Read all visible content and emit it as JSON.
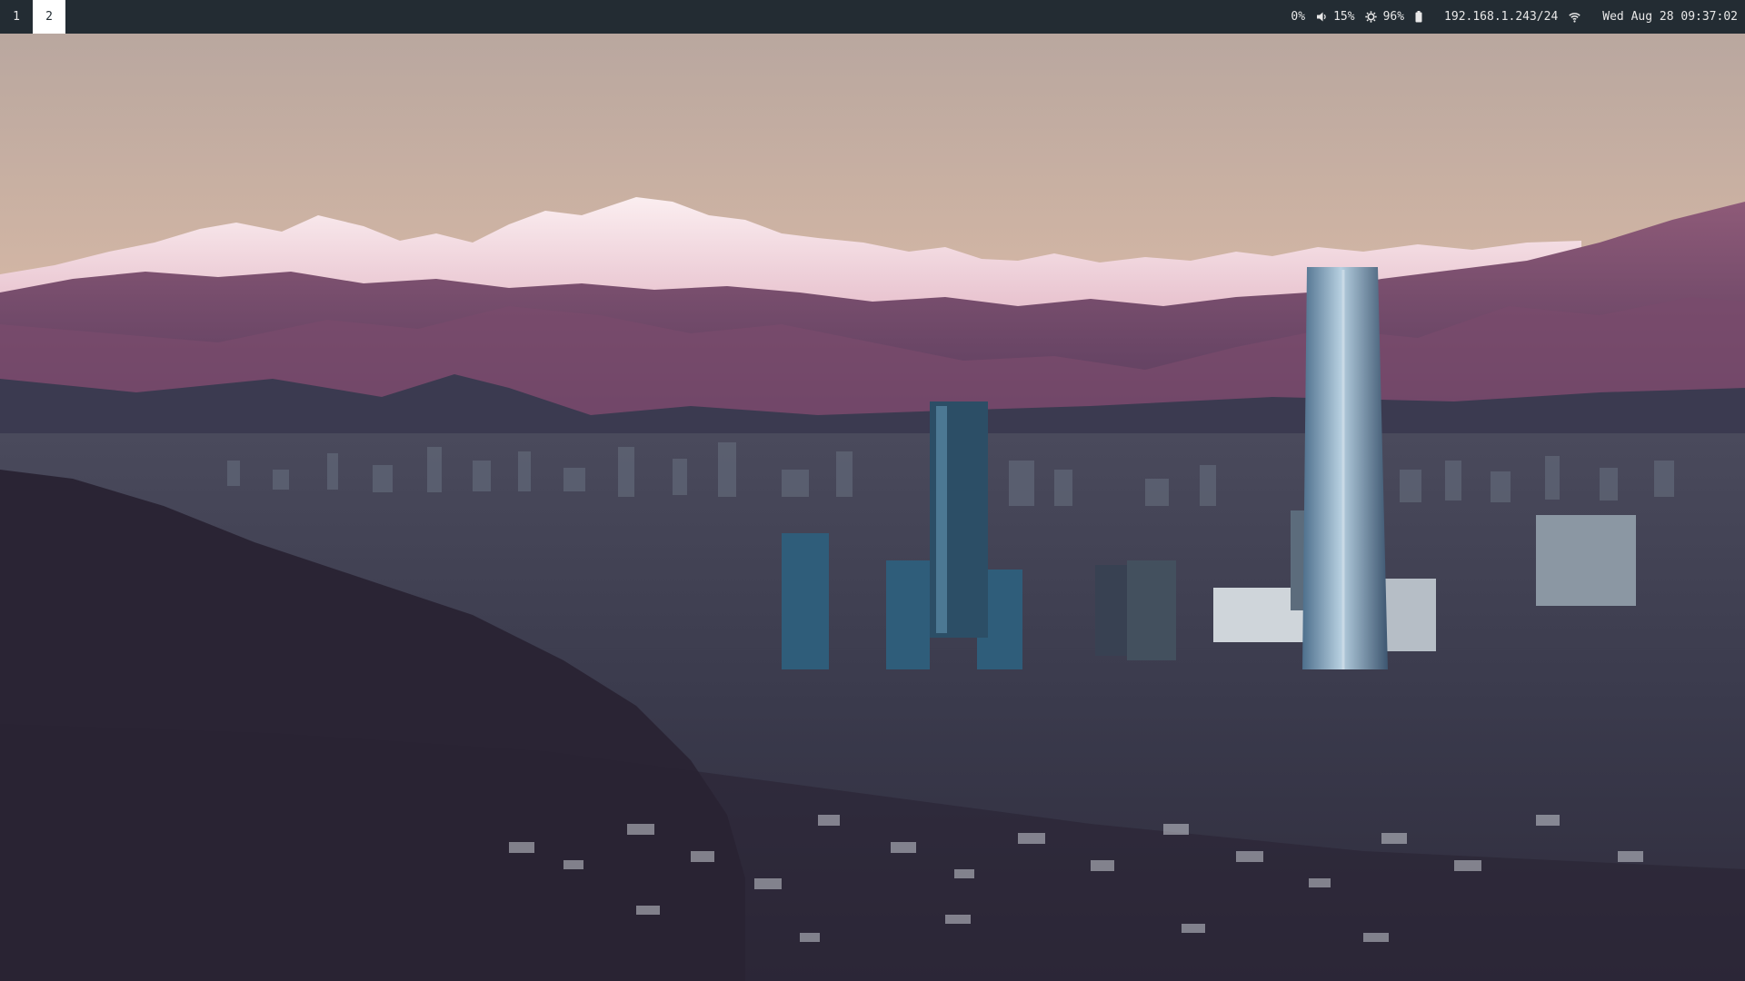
{
  "workspaces": [
    {
      "label": "1",
      "focused": false
    },
    {
      "label": "2",
      "focused": true
    }
  ],
  "status": {
    "cpu": "0%",
    "volume": "15%",
    "brightness": "96%",
    "network": "192.168.1.243/24",
    "datetime": "Wed Aug 28 09:37:02"
  },
  "icons": {
    "volume": "speaker-icon",
    "brightness": "brightness-icon",
    "battery": "battery-icon",
    "wifi": "wifi-icon"
  },
  "colors": {
    "bar_bg": "#232c33",
    "focused_ws_bg": "#ffffff",
    "text": "#e8e8e8"
  }
}
